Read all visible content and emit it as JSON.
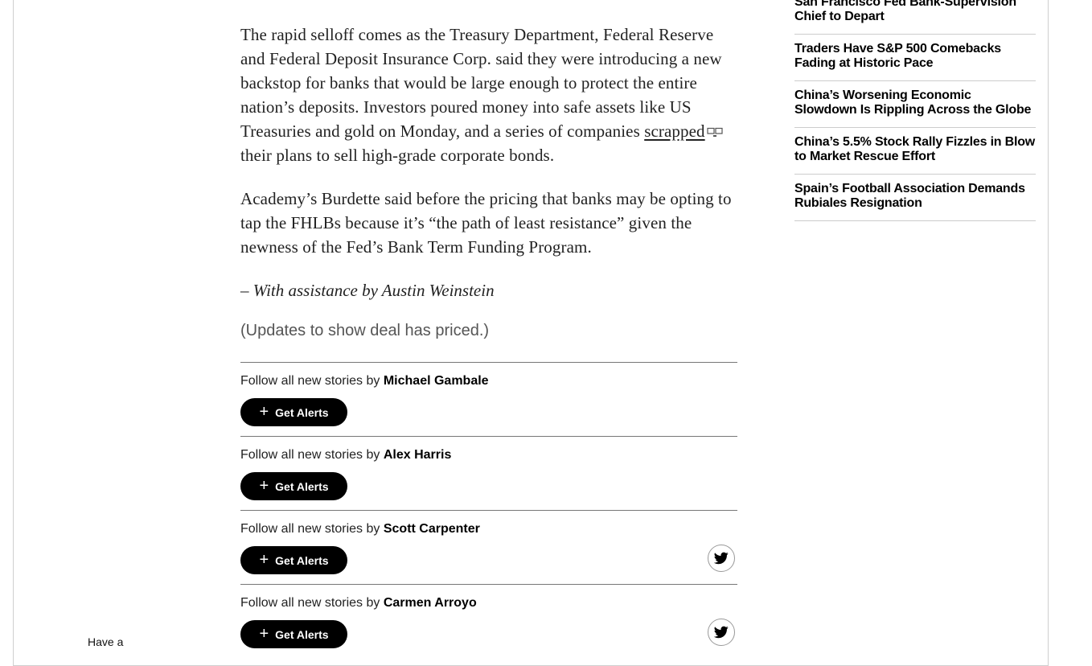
{
  "article": {
    "paragraph1_before_link": "The rapid selloff comes as the Treasury Department, Federal Reserve and Federal Deposit Insurance Corp. said they were introducing a new backstop for banks that would be large enough to protect the entire nation’s deposits. Investors poured money into safe assets like US Treasuries and gold on Monday, and a series of companies ",
    "paragraph1_link": "scrapped",
    "paragraph1_after_link": " their plans to sell high-grade corporate bonds.",
    "paragraph2": "Academy’s Burdette said before the pricing that banks may be opting to tap the FHLBs because it’s “the path of least resistance” given the newness of the Fed’s Bank Term Funding Program.",
    "byline_dash": "– ",
    "byline_italic": "With assistance by Austin Weinstein",
    "update_note": "(Updates to show deal has priced.)"
  },
  "follow": {
    "prefix": "Follow all new stories by ",
    "button_label": "Get Alerts",
    "plus_icon": "+",
    "authors": [
      {
        "name": "Michael Gambale",
        "twitter": false
      },
      {
        "name": "Alex Harris",
        "twitter": false
      },
      {
        "name": "Scott Carpenter",
        "twitter": true
      },
      {
        "name": "Carmen Arroyo",
        "twitter": true
      }
    ]
  },
  "sidebar": {
    "items": [
      "San Francisco Fed Bank-Supervision Chief to Depart",
      "Traders Have S&P 500 Comebacks Fading at Historic Pace",
      "China’s Worsening Economic Slowdown Is Rippling Across the Globe",
      "China’s 5.5% Stock Rally Fizzles in Blow to Market Rescue Effort",
      "Spain’s Football Association Demands Rubiales Resignation"
    ]
  },
  "footer": {
    "have_a": "Have a"
  },
  "colors": {
    "button_bg": "#000000",
    "text": "#222222",
    "muted": "#555555"
  }
}
